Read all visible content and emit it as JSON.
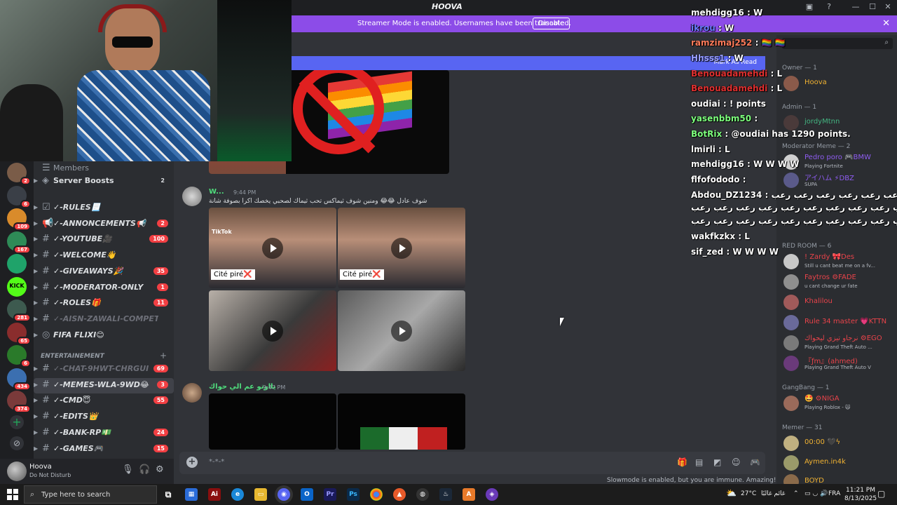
{
  "window": {
    "title": "HOOVA"
  },
  "banner": {
    "text": "Streamer Mode is enabled. Usernames have been truncated.",
    "disable_label": "Disable"
  },
  "mark_read": {
    "label": "Mark As Read"
  },
  "rail": {
    "servers": [
      {
        "badge": "2",
        "color": "#7a5c48"
      },
      {
        "badge": "6",
        "color": "#3a3f47"
      },
      {
        "badge": "109",
        "color": "#d98b2b"
      },
      {
        "badge": "167",
        "color": "#2e8b57"
      },
      {
        "badge": "",
        "color": "#1fa36a"
      },
      {
        "badge": "",
        "color": "#53fc18"
      },
      {
        "badge": "281",
        "color": "#3d5a4f"
      },
      {
        "badge": "65",
        "color": "#8a2d2d"
      },
      {
        "badge": "6",
        "color": "#2a7a2a"
      },
      {
        "badge": "434",
        "color": "#3b6fb0"
      },
      {
        "badge": "374",
        "color": "#7a3a3a"
      }
    ],
    "kick_label": "KICK"
  },
  "sidebar": {
    "members_label": "Members",
    "boosts_label": "Server Boosts",
    "boosts_count": "2",
    "channels": [
      {
        "name": "✓-RULES📃",
        "count": "",
        "muted": false,
        "icon": "☑"
      },
      {
        "name": "✓-ANNONCEMENTS📢",
        "count": "2",
        "muted": false,
        "icon": "📢"
      },
      {
        "name": "✓-YOUTUBE🎥",
        "count": "100",
        "muted": false,
        "icon": "#"
      },
      {
        "name": "✓-WELCOME👋",
        "count": "",
        "muted": false,
        "icon": "#"
      },
      {
        "name": "✓-GIVEAWAYS🎉",
        "count": "35",
        "muted": false,
        "icon": "#"
      },
      {
        "name": "✓-MODERATOR-ONLY",
        "count": "1",
        "muted": false,
        "icon": "#"
      },
      {
        "name": "✓-ROLES🎁",
        "count": "11",
        "muted": false,
        "icon": "#"
      },
      {
        "name": "✓-AISN-ZAWALI-COMPETE...",
        "count": "",
        "muted": true,
        "icon": "#"
      },
      {
        "name": "FIFA FLIXI😊",
        "count": "",
        "muted": false,
        "icon": "◎"
      }
    ],
    "category": "ENTERTAINEMENT",
    "channels2": [
      {
        "name": "✓-CHAT-9HWT-CHRGUI",
        "count": "69",
        "muted": true,
        "active": false
      },
      {
        "name": "✓-MEMES-WLA-9WD😂",
        "count": "3",
        "muted": false,
        "active": true
      },
      {
        "name": "✓-CMD😇",
        "count": "55",
        "muted": false,
        "active": false
      },
      {
        "name": "✓-EDITS👑",
        "count": "",
        "muted": false,
        "active": false
      },
      {
        "name": "✓-BANK-RP💵",
        "count": "24",
        "muted": false,
        "active": false
      },
      {
        "name": "✓-GAMES🎮",
        "count": "15",
        "muted": false,
        "active": false
      }
    ]
  },
  "user": {
    "name": "Hoova",
    "status": "Do Not Disturb"
  },
  "messages": [
    {
      "author": "W...",
      "time": "9:44 PM",
      "text": "شوف عادل 😂😂 ومنين شوف ثيماكس تحب ثيماك لصحبي يخصك اكرا بصوفة شانة",
      "captions": [
        "Cité piré❌",
        "Cité piré❌"
      ],
      "tiktok": "TikTok"
    },
    {
      "author": "يااوتو عم الي حواك",
      "time": "9:47 PM"
    }
  ],
  "composer": {
    "placeholder": "*-*-*"
  },
  "slowmode": "Slowmode is enabled, but you are immune. Amazing!",
  "members": {
    "groups": [
      {
        "title": "Owner — 1",
        "items": [
          {
            "name": "Hoova",
            "sub": "",
            "color": "#f0b232",
            "av": "#8a5a4a"
          }
        ]
      },
      {
        "title": "Admin — 1",
        "items": [
          {
            "name": "jordyMtnn",
            "sub": "",
            "color": "#43b581",
            "av": "#4a3a3a"
          }
        ]
      },
      {
        "title": "Moderator Meme — 2",
        "items": [
          {
            "name": "Pedro poro 🎮BMW",
            "sub": "Playing Fortnite",
            "color": "#8e5cf0",
            "av": "#d0d0d0"
          },
          {
            "name": "アイハム ⚡DBZ",
            "sub": "SUPA",
            "color": "#8e5cf0",
            "av": "#5a5a8a"
          }
        ]
      },
      {
        "title": "RED ROOM — 6",
        "items": [
          {
            "name": "! Zardy 🎀Des",
            "sub": "Still u cant beat me on a fv...",
            "color": "#e8434a",
            "av": "#c8c8c8"
          },
          {
            "name": "Faytros ⚙FADE",
            "sub": "u cant change ur fate",
            "color": "#e8434a",
            "av": "#8f8f8f"
          },
          {
            "name": "Khalilou",
            "sub": "",
            "color": "#e8434a",
            "av": "#a05a5a"
          },
          {
            "name": "Rule 34 master 💗KTTN",
            "sub": "",
            "color": "#e8434a",
            "av": "#6a6a9a"
          },
          {
            "name": "نرجاو تيزي ليحواك ⚙EGO",
            "sub": "Playing Grand Theft Auto ...",
            "color": "#e8434a",
            "av": "#7a7a7a"
          },
          {
            "name": "『ƒm』(ahmed)",
            "sub": "Playing Grand Theft Auto V",
            "color": "#e8434a",
            "av": "#6a3a7a"
          }
        ]
      },
      {
        "title": "GangBang — 1",
        "items": [
          {
            "name": "🤩 ⚙NIGA",
            "sub": "Playing Roblox - 🙀",
            "color": "#e8434a",
            "av": "#9a6a5a"
          }
        ]
      },
      {
        "title": "Memer — 31",
        "items": [
          {
            "name": "00:00 🖤ϟ",
            "sub": "",
            "color": "#f0b232",
            "av": "#c0b080"
          },
          {
            "name": "Aymen.in4k",
            "sub": "",
            "color": "#f0b232",
            "av": "#9a9a6a"
          },
          {
            "name": "BOYD",
            "sub": "",
            "color": "#f0b232",
            "av": "#8a6a4a"
          }
        ]
      }
    ]
  },
  "overlay": [
    {
      "user": "mehdigg16",
      "msg": "W",
      "color": "#ffffff"
    },
    {
      "user": "ikrou",
      "msg": "W",
      "color": "#6a7bff"
    },
    {
      "user": "ramzimaj252",
      "msg": "🏳️‍🌈 🏳️‍🌈",
      "color": "#ff7b5a"
    },
    {
      "user": "Hhsss1",
      "msg": "W",
      "color": "#9aa0ff"
    },
    {
      "user": "Benouadamehdi",
      "msg": "L",
      "color": "#e03030"
    },
    {
      "user": "Benouadamehdi",
      "msg": "L",
      "color": "#e03030"
    },
    {
      "user": "oudiai",
      "msg": "! points",
      "color": "#ffffff"
    },
    {
      "user": "yasenbbm50",
      "msg": "",
      "color": "#7dff7d"
    },
    {
      "user": "BotRix",
      "msg": "@oudiai has 1290 points.",
      "color": "#7dff7d"
    },
    {
      "user": "lmirli",
      "msg": "L",
      "color": "#ffffff"
    },
    {
      "user": "mehdigg16",
      "msg": "W W W W",
      "color": "#ffffff"
    },
    {
      "user": "flfofododo",
      "msg": "",
      "color": "#ffffff"
    },
    {
      "user": "Abdou_DZ1234",
      "msg": "رعب رعب رعب رعب رعب رعب رعب",
      "color": "#ffffff"
    },
    {
      "user": "",
      "msg": "رعب رعب رعب رعب رعب رعب رعب رعب رعب رعب",
      "color": "#ffffff"
    },
    {
      "user": "",
      "msg": "رعب رعب رعب رعب رعب رعب رعب رعب رعب رعب",
      "color": "#ffffff"
    },
    {
      "user": "wakfkzkx",
      "msg": "L",
      "color": "#ffffff"
    },
    {
      "user": "sif_zed",
      "msg": "W W W W",
      "color": "#ffffff"
    }
  ],
  "taskbar": {
    "search_placeholder": "Type here to search",
    "weather": "27°C",
    "weather_text": "غائم غالبًا",
    "lang": "FRA",
    "time": "11:21 PM",
    "date": "8/13/2025"
  }
}
